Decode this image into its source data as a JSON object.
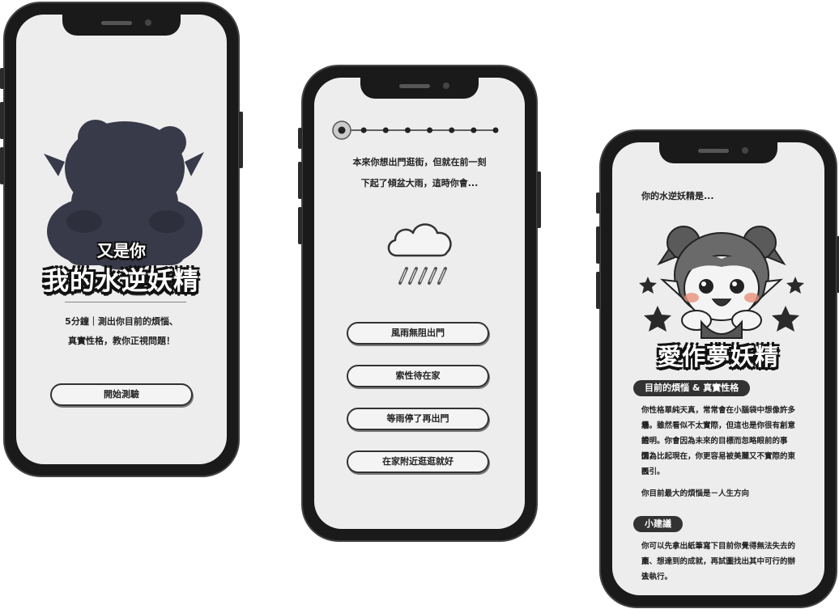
{
  "intro": {
    "subtitle": "又是你",
    "title": "我的水逆妖精",
    "desc_line1": "5分鐘｜測出你目前的煩惱、",
    "desc_line2": "真實性格，教你正視問題！",
    "start_label": "開始測驗"
  },
  "quiz": {
    "question_line1": "本來你想出門逛街，但就在前一刻",
    "question_line2": "下起了傾盆大雨，這時你會...",
    "progress": {
      "current": 1,
      "total": 8
    },
    "weather_icon": "rain-cloud-icon",
    "options": [
      "風雨無阻出門",
      "索性待在家",
      "等雨停了再出門",
      "在家附近逛逛就好"
    ]
  },
  "result": {
    "intro": "你的水逆妖精是...",
    "name": "愛作夢妖精",
    "section1_label": "目前的煩惱 & 真實性格",
    "personality_lines": [
      "你性格單純天真，常常會在小腦袋中想像許多場",
      "景。雖然看似不太實際，但這也是你很有創意的",
      "證明。你會因為未來的目標而忽略眼前的事情，",
      "因為比起現在，你更容易被美麗又不實際的東西",
      "吸引。"
    ],
    "worry": "你目前最大的煩惱是－人生方向",
    "section2_label": "小建議",
    "advice_lines": [
      "你可以先拿出紙筆寫下目前你覺得無法失去的東",
      "西、想達到的成就，再試圖找出其中可行的辦法",
      "去執行。"
    ]
  },
  "colors": {
    "phone_frame": "#1a1a1a",
    "screen_bg": "#ededed",
    "silhouette": "#383a4a",
    "tag_bg": "#333333"
  }
}
